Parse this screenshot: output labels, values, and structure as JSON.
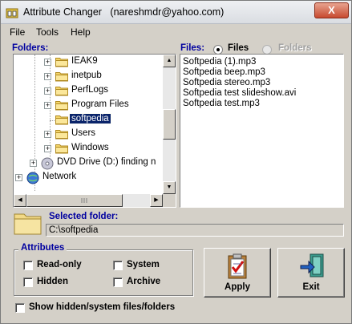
{
  "window": {
    "title": "Attribute Changer",
    "subtitle": "(nareshmdr@yahoo.com)",
    "close_label": "X"
  },
  "menu": [
    "File",
    "Tools",
    "Help"
  ],
  "folders_label": "Folders:",
  "tree": [
    {
      "label": "IEAK9",
      "expander": "+",
      "selected": false
    },
    {
      "label": "inetpub",
      "expander": "+",
      "selected": false
    },
    {
      "label": "PerfLogs",
      "expander": "+",
      "selected": false
    },
    {
      "label": "Program Files",
      "expander": "+",
      "selected": false
    },
    {
      "label": "softpedia",
      "expander": "",
      "selected": true
    },
    {
      "label": "Users",
      "expander": "+",
      "selected": false
    },
    {
      "label": "Windows",
      "expander": "+",
      "selected": false
    },
    {
      "label": "DVD Drive (D:) finding n",
      "expander": "+",
      "selected": false
    },
    {
      "label": "Network",
      "expander": "+",
      "selected": false
    }
  ],
  "files_section": {
    "label": "Files:",
    "radio_files": "Files",
    "radio_folders": "Folders",
    "items": [
      "Softpedia (1).mp3",
      "Softpedia beep.mp3",
      "Softpedia stereo.mp3",
      "Softpedia test slideshow.avi",
      "Softpedia test.mp3"
    ]
  },
  "selected_folder": {
    "label": "Selected folder:",
    "path": "C:\\softpedia"
  },
  "attributes": {
    "title": "Attributes",
    "read_only": "Read-only",
    "hidden": "Hidden",
    "system": "System",
    "archive": "Archive"
  },
  "apply_label": "Apply",
  "exit_label": "Exit",
  "show_hidden_label": "Show hidden/system files/folders",
  "colors": {
    "label_blue": "#0000a0",
    "selection": "#0a246a",
    "face": "#d4d0c8"
  }
}
